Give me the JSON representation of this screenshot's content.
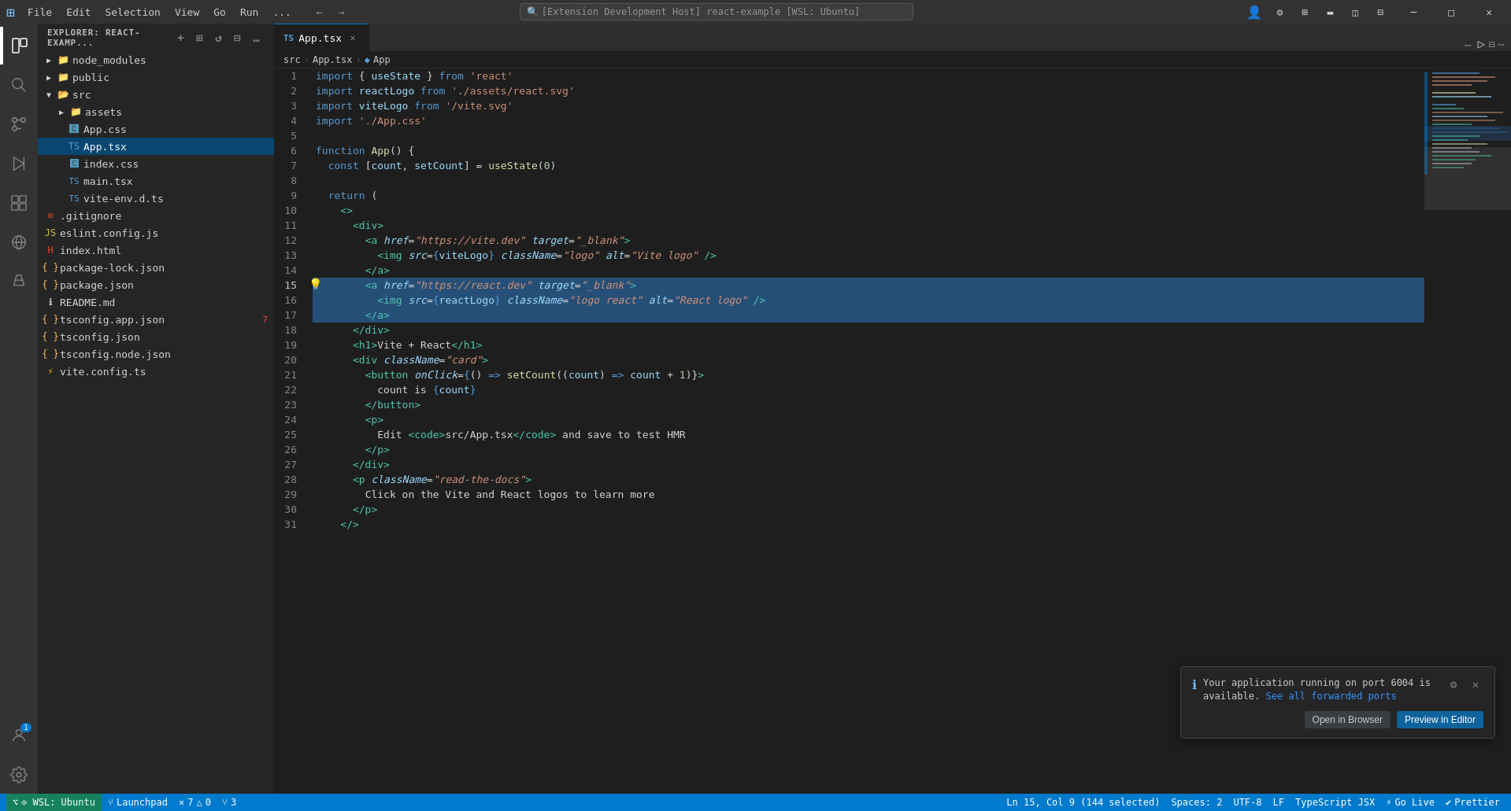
{
  "titlebar": {
    "appname": "VS Code",
    "menus": [
      "File",
      "Edit",
      "Selection",
      "View",
      "Go",
      "Run",
      "..."
    ],
    "searchPlaceholder": "[Extension Development Host] react-example [WSL: Ubuntu]",
    "winBtns": [
      "─",
      "□",
      "×"
    ]
  },
  "activitybar": {
    "items": [
      {
        "name": "explorer",
        "icon": "⎘",
        "active": true
      },
      {
        "name": "search",
        "icon": "🔍",
        "active": false
      },
      {
        "name": "source-control",
        "icon": "⑂",
        "active": false
      },
      {
        "name": "run-debug",
        "icon": "▶",
        "active": false
      },
      {
        "name": "extensions",
        "icon": "⊞",
        "active": false
      },
      {
        "name": "remote-explorer",
        "icon": "⊙",
        "active": false
      },
      {
        "name": "testing",
        "icon": "⚗",
        "active": false
      }
    ],
    "bottomItems": [
      {
        "name": "accounts",
        "icon": "⊙",
        "badge": "1"
      },
      {
        "name": "settings",
        "icon": "⚙"
      }
    ]
  },
  "sidebar": {
    "title": "EXPLORER: REACT-EXAMP...",
    "actions": [
      "new-file",
      "new-folder",
      "refresh",
      "collapse"
    ],
    "tree": [
      {
        "label": "node_modules",
        "type": "folder",
        "indent": 8,
        "open": false
      },
      {
        "label": "public",
        "type": "folder",
        "indent": 8,
        "open": false
      },
      {
        "label": "src",
        "type": "folder",
        "indent": 8,
        "open": true
      },
      {
        "label": "assets",
        "type": "folder",
        "indent": 24,
        "open": false
      },
      {
        "label": "App.css",
        "type": "file-css",
        "indent": 28
      },
      {
        "label": "App.tsx",
        "type": "file-tsx",
        "indent": 28,
        "selected": true
      },
      {
        "label": "index.css",
        "type": "file-css",
        "indent": 28
      },
      {
        "label": "main.tsx",
        "type": "file-tsx",
        "indent": 28
      },
      {
        "label": "vite-env.d.ts",
        "type": "file-ts",
        "indent": 28
      },
      {
        "label": ".gitignore",
        "type": "file-gitignore",
        "indent": 8
      },
      {
        "label": "eslint.config.js",
        "type": "file-js",
        "indent": 8
      },
      {
        "label": "index.html",
        "type": "file-html",
        "indent": 8
      },
      {
        "label": "package-lock.json",
        "type": "file-json",
        "indent": 8
      },
      {
        "label": "package.json",
        "type": "file-json",
        "indent": 8
      },
      {
        "label": "README.md",
        "type": "file-md",
        "indent": 8
      },
      {
        "label": "tsconfig.app.json",
        "type": "file-json",
        "indent": 8,
        "badge": "7"
      },
      {
        "label": "tsconfig.json",
        "type": "file-json",
        "indent": 8
      },
      {
        "label": "tsconfig.node.json",
        "type": "file-json",
        "indent": 8
      },
      {
        "label": "vite.config.ts",
        "type": "file-ts",
        "indent": 8
      }
    ]
  },
  "tabs": [
    {
      "label": "App.tsx",
      "active": true,
      "icon": "tsx"
    }
  ],
  "breadcrumb": [
    "src",
    ">",
    "App.tsx",
    ">",
    "App"
  ],
  "lines": [
    {
      "num": 1,
      "tokens": [
        {
          "t": "kw",
          "v": "import"
        },
        {
          "t": "punct",
          "v": " { "
        },
        {
          "t": "var",
          "v": "useState"
        },
        {
          "t": "punct",
          "v": " } "
        },
        {
          "t": "kw",
          "v": "from"
        },
        {
          "t": "str",
          "v": " 'react'"
        }
      ]
    },
    {
      "num": 2,
      "tokens": [
        {
          "t": "kw",
          "v": "import"
        },
        {
          "t": "var",
          "v": " reactLogo"
        },
        {
          "t": "kw",
          "v": " from"
        },
        {
          "t": "str",
          "v": " './assets/react.svg'"
        }
      ]
    },
    {
      "num": 3,
      "tokens": [
        {
          "t": "kw",
          "v": "import"
        },
        {
          "t": "var",
          "v": " viteLogo"
        },
        {
          "t": "kw",
          "v": " from"
        },
        {
          "t": "str",
          "v": " '/vite.svg'"
        }
      ]
    },
    {
      "num": 4,
      "tokens": [
        {
          "t": "kw",
          "v": "import"
        },
        {
          "t": "str",
          "v": " './App.css'"
        }
      ]
    },
    {
      "num": 5,
      "tokens": []
    },
    {
      "num": 6,
      "tokens": [
        {
          "t": "kw",
          "v": "function"
        },
        {
          "t": "fn",
          "v": " App"
        },
        {
          "t": "punct",
          "v": "() {"
        }
      ]
    },
    {
      "num": 7,
      "tokens": [
        {
          "t": "text",
          "v": "  "
        },
        {
          "t": "kw",
          "v": "const"
        },
        {
          "t": "punct",
          "v": " ["
        },
        {
          "t": "var",
          "v": "count"
        },
        {
          "t": "punct",
          "v": ", "
        },
        {
          "t": "var",
          "v": "setCount"
        },
        {
          "t": "punct",
          "v": "] = "
        },
        {
          "t": "fn",
          "v": "useState"
        },
        {
          "t": "punct",
          "v": "("
        },
        {
          "t": "num",
          "v": "0"
        },
        {
          "t": "punct",
          "v": ")"
        }
      ]
    },
    {
      "num": 8,
      "tokens": []
    },
    {
      "num": 9,
      "tokens": [
        {
          "t": "text",
          "v": "  "
        },
        {
          "t": "kw",
          "v": "return"
        },
        {
          "t": "punct",
          "v": " ("
        }
      ]
    },
    {
      "num": 10,
      "tokens": [
        {
          "t": "text",
          "v": "    "
        },
        {
          "t": "tag",
          "v": "<>"
        }
      ]
    },
    {
      "num": 11,
      "tokens": [
        {
          "t": "text",
          "v": "      "
        },
        {
          "t": "tag",
          "v": "<div>"
        }
      ]
    },
    {
      "num": 12,
      "tokens": [
        {
          "t": "text",
          "v": "        "
        },
        {
          "t": "tag",
          "v": "<a"
        },
        {
          "t": "attr",
          "v": " href"
        },
        {
          "t": "punct",
          "v": "="
        },
        {
          "t": "attr-val",
          "v": "\"https://vite.dev\""
        },
        {
          "t": "attr",
          "v": " target"
        },
        {
          "t": "punct",
          "v": "="
        },
        {
          "t": "attr-val",
          "v": "\"_blank\""
        },
        {
          "t": "tag",
          "v": ">"
        }
      ]
    },
    {
      "num": 13,
      "tokens": [
        {
          "t": "text",
          "v": "          "
        },
        {
          "t": "tag",
          "v": "<img"
        },
        {
          "t": "attr",
          "v": " src"
        },
        {
          "t": "punct",
          "v": "="
        },
        {
          "t": "jsx-expr",
          "v": "{"
        },
        {
          "t": "var",
          "v": "viteLogo"
        },
        {
          "t": "jsx-expr",
          "v": "}"
        },
        {
          "t": "attr",
          "v": " className"
        },
        {
          "t": "punct",
          "v": "="
        },
        {
          "t": "attr-val",
          "v": "\"logo\""
        },
        {
          "t": "attr",
          "v": " alt"
        },
        {
          "t": "punct",
          "v": "="
        },
        {
          "t": "attr-val",
          "v": "\"Vite logo\""
        },
        {
          "t": "tag",
          "v": " />"
        }
      ]
    },
    {
      "num": 14,
      "tokens": [
        {
          "t": "text",
          "v": "        "
        },
        {
          "t": "tag",
          "v": "</a>"
        }
      ]
    },
    {
      "num": 15,
      "tokens": [
        {
          "t": "text",
          "v": "        "
        },
        {
          "t": "tag",
          "v": "<a"
        },
        {
          "t": "attr",
          "v": " href"
        },
        {
          "t": "punct",
          "v": "="
        },
        {
          "t": "attr-val",
          "v": "\"https://react.dev\""
        },
        {
          "t": "attr",
          "v": " target"
        },
        {
          "t": "punct",
          "v": "="
        },
        {
          "t": "attr-val",
          "v": "\"_blank\""
        },
        {
          "t": "tag",
          "v": ">"
        }
      ],
      "selected": true
    },
    {
      "num": 16,
      "tokens": [
        {
          "t": "text",
          "v": "          "
        },
        {
          "t": "tag",
          "v": "<img"
        },
        {
          "t": "attr",
          "v": " src"
        },
        {
          "t": "punct",
          "v": "="
        },
        {
          "t": "jsx-expr",
          "v": "{"
        },
        {
          "t": "var",
          "v": "reactLogo"
        },
        {
          "t": "jsx-expr",
          "v": "}"
        },
        {
          "t": "attr",
          "v": " className"
        },
        {
          "t": "punct",
          "v": "="
        },
        {
          "t": "attr-val",
          "v": "\"logo react\""
        },
        {
          "t": "attr",
          "v": " alt"
        },
        {
          "t": "punct",
          "v": "="
        },
        {
          "t": "attr-val",
          "v": "\"React logo\""
        },
        {
          "t": "tag",
          "v": " />"
        }
      ],
      "selected": true
    },
    {
      "num": 17,
      "tokens": [
        {
          "t": "text",
          "v": "        "
        },
        {
          "t": "tag",
          "v": "</a>"
        }
      ],
      "selected": true
    },
    {
      "num": 18,
      "tokens": [
        {
          "t": "text",
          "v": "      "
        },
        {
          "t": "tag",
          "v": "</div>"
        }
      ]
    },
    {
      "num": 19,
      "tokens": [
        {
          "t": "text",
          "v": "      "
        },
        {
          "t": "tag",
          "v": "<h1>"
        },
        {
          "t": "jsx-text",
          "v": "Vite + React"
        },
        {
          "t": "tag",
          "v": "</h1>"
        }
      ]
    },
    {
      "num": 20,
      "tokens": [
        {
          "t": "text",
          "v": "      "
        },
        {
          "t": "tag",
          "v": "<div"
        },
        {
          "t": "attr",
          "v": " className"
        },
        {
          "t": "punct",
          "v": "="
        },
        {
          "t": "attr-val",
          "v": "\"card\""
        },
        {
          "t": "tag",
          "v": ">"
        }
      ]
    },
    {
      "num": 21,
      "tokens": [
        {
          "t": "text",
          "v": "        "
        },
        {
          "t": "tag",
          "v": "<button"
        },
        {
          "t": "attr",
          "v": " onClick"
        },
        {
          "t": "punct",
          "v": "="
        },
        {
          "t": "jsx-expr",
          "v": "{"
        },
        {
          "t": "punct",
          "v": "() "
        },
        {
          "t": "arrow",
          "v": "⇒"
        },
        {
          "t": "fn",
          "v": " setCount"
        },
        {
          "t": "punct",
          "v": "(("
        },
        {
          "t": "var",
          "v": "count"
        },
        {
          "t": "punct",
          "v": ") "
        },
        {
          "t": "arrow",
          "v": "⇒"
        },
        {
          "t": "var",
          "v": " count"
        },
        {
          "t": "punct",
          "v": " + "
        },
        {
          "t": "num",
          "v": "1"
        },
        {
          "t": "punct",
          "v": ")}"
        },
        {
          "t": "tag",
          "v": ">"
        }
      ]
    },
    {
      "num": 22,
      "tokens": [
        {
          "t": "text",
          "v": "          "
        },
        {
          "t": "jsx-text",
          "v": "count is "
        },
        {
          "t": "jsx-expr",
          "v": "{"
        },
        {
          "t": "var",
          "v": "count"
        },
        {
          "t": "jsx-expr",
          "v": "}"
        }
      ]
    },
    {
      "num": 23,
      "tokens": [
        {
          "t": "text",
          "v": "        "
        },
        {
          "t": "tag",
          "v": "</button>"
        }
      ]
    },
    {
      "num": 24,
      "tokens": [
        {
          "t": "text",
          "v": "        "
        },
        {
          "t": "tag",
          "v": "<p>"
        }
      ]
    },
    {
      "num": 25,
      "tokens": [
        {
          "t": "text",
          "v": "          "
        },
        {
          "t": "jsx-text",
          "v": "Edit "
        },
        {
          "t": "tag",
          "v": "<code>"
        },
        {
          "t": "jsx-text",
          "v": "src/App.tsx"
        },
        {
          "t": "tag",
          "v": "</code>"
        },
        {
          "t": "jsx-text",
          "v": " and save to test HMR"
        }
      ]
    },
    {
      "num": 26,
      "tokens": [
        {
          "t": "text",
          "v": "        "
        },
        {
          "t": "tag",
          "v": "</p>"
        }
      ]
    },
    {
      "num": 27,
      "tokens": [
        {
          "t": "text",
          "v": "      "
        },
        {
          "t": "tag",
          "v": "</div>"
        }
      ]
    },
    {
      "num": 28,
      "tokens": [
        {
          "t": "text",
          "v": "      "
        },
        {
          "t": "tag",
          "v": "<p"
        },
        {
          "t": "attr",
          "v": " className"
        },
        {
          "t": "punct",
          "v": "="
        },
        {
          "t": "attr-val",
          "v": "\"read-the-docs\""
        },
        {
          "t": "tag",
          "v": ">"
        }
      ]
    },
    {
      "num": 29,
      "tokens": [
        {
          "t": "text",
          "v": "        "
        },
        {
          "t": "jsx-text",
          "v": "Click on the Vite and React logos to learn more"
        }
      ]
    },
    {
      "num": 30,
      "tokens": [
        {
          "t": "text",
          "v": "      "
        },
        {
          "t": "tag",
          "v": "</p>"
        }
      ]
    },
    {
      "num": 31,
      "tokens": [
        {
          "t": "text",
          "v": "    "
        },
        {
          "t": "tag",
          "v": "</>"
        }
      ]
    }
  ],
  "notification": {
    "text": "Your application running on port 6004 is available.",
    "link": "See all forwarded ports",
    "btn1": "Open in Browser",
    "btn2": "Preview in Editor"
  },
  "statusbar": {
    "remote": "⎆  WSL: Ubuntu",
    "branch": "⑂  Launchpad",
    "errors": "✕ 7  △ 0",
    "ports": "⑂ 3",
    "position": "Ln 15, Col 9 (144 selected)",
    "spaces": "Spaces: 2",
    "encoding": "UTF-8",
    "eol": "LF",
    "language": "TypeScript JSX",
    "golive": "⚡ Go Live",
    "prettier": "⊙ Prettier"
  }
}
